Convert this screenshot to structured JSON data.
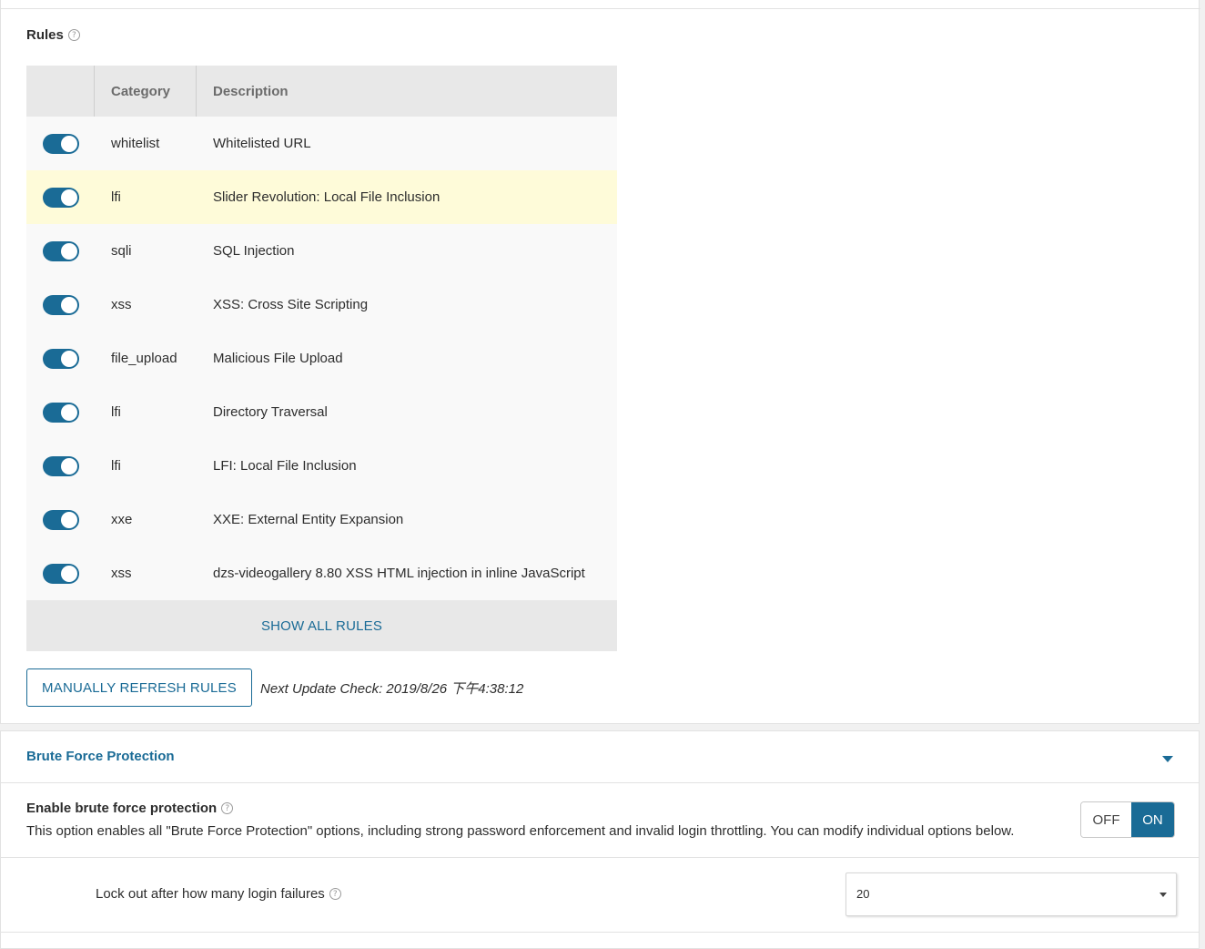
{
  "rules_section": {
    "heading": "Rules",
    "help_icon": "?",
    "columns": {
      "category": "Category",
      "description": "Description"
    },
    "rows": [
      {
        "enabled": true,
        "category": "whitelist",
        "description": "Whitelisted URL",
        "highlight": false
      },
      {
        "enabled": true,
        "category": "lfi",
        "description": "Slider Revolution: Local File Inclusion",
        "highlight": true
      },
      {
        "enabled": true,
        "category": "sqli",
        "description": "SQL Injection",
        "highlight": false
      },
      {
        "enabled": true,
        "category": "xss",
        "description": "XSS: Cross Site Scripting",
        "highlight": false
      },
      {
        "enabled": true,
        "category": "file_upload",
        "description": "Malicious File Upload",
        "highlight": false
      },
      {
        "enabled": true,
        "category": "lfi",
        "description": "Directory Traversal",
        "highlight": false
      },
      {
        "enabled": true,
        "category": "lfi",
        "description": "LFI: Local File Inclusion",
        "highlight": false
      },
      {
        "enabled": true,
        "category": "xxe",
        "description": "XXE: External Entity Expansion",
        "highlight": false
      },
      {
        "enabled": true,
        "category": "xss",
        "description": "dzs-videogallery 8.80 XSS HTML injection in inline JavaScript",
        "highlight": false
      }
    ],
    "show_all_label": "SHOW ALL RULES",
    "refresh_button": "MANUALLY REFRESH RULES",
    "next_update": "Next Update Check: 2019/8/26 下午4:38:12"
  },
  "brute_force": {
    "title": "Brute Force Protection",
    "enable_title": "Enable brute force protection",
    "enable_desc": "This option enables all \"Brute Force Protection\" options, including strong password enforcement and invalid login throttling. You can modify individual options below.",
    "toggle": {
      "off": "OFF",
      "on": "ON",
      "state": "on"
    },
    "lockout_label": "Lock out after how many login failures",
    "lockout_value": "20"
  },
  "colors": {
    "accent": "#1a6b96",
    "highlight_row": "#fefbd9",
    "header_bg": "#e8e8e8"
  }
}
